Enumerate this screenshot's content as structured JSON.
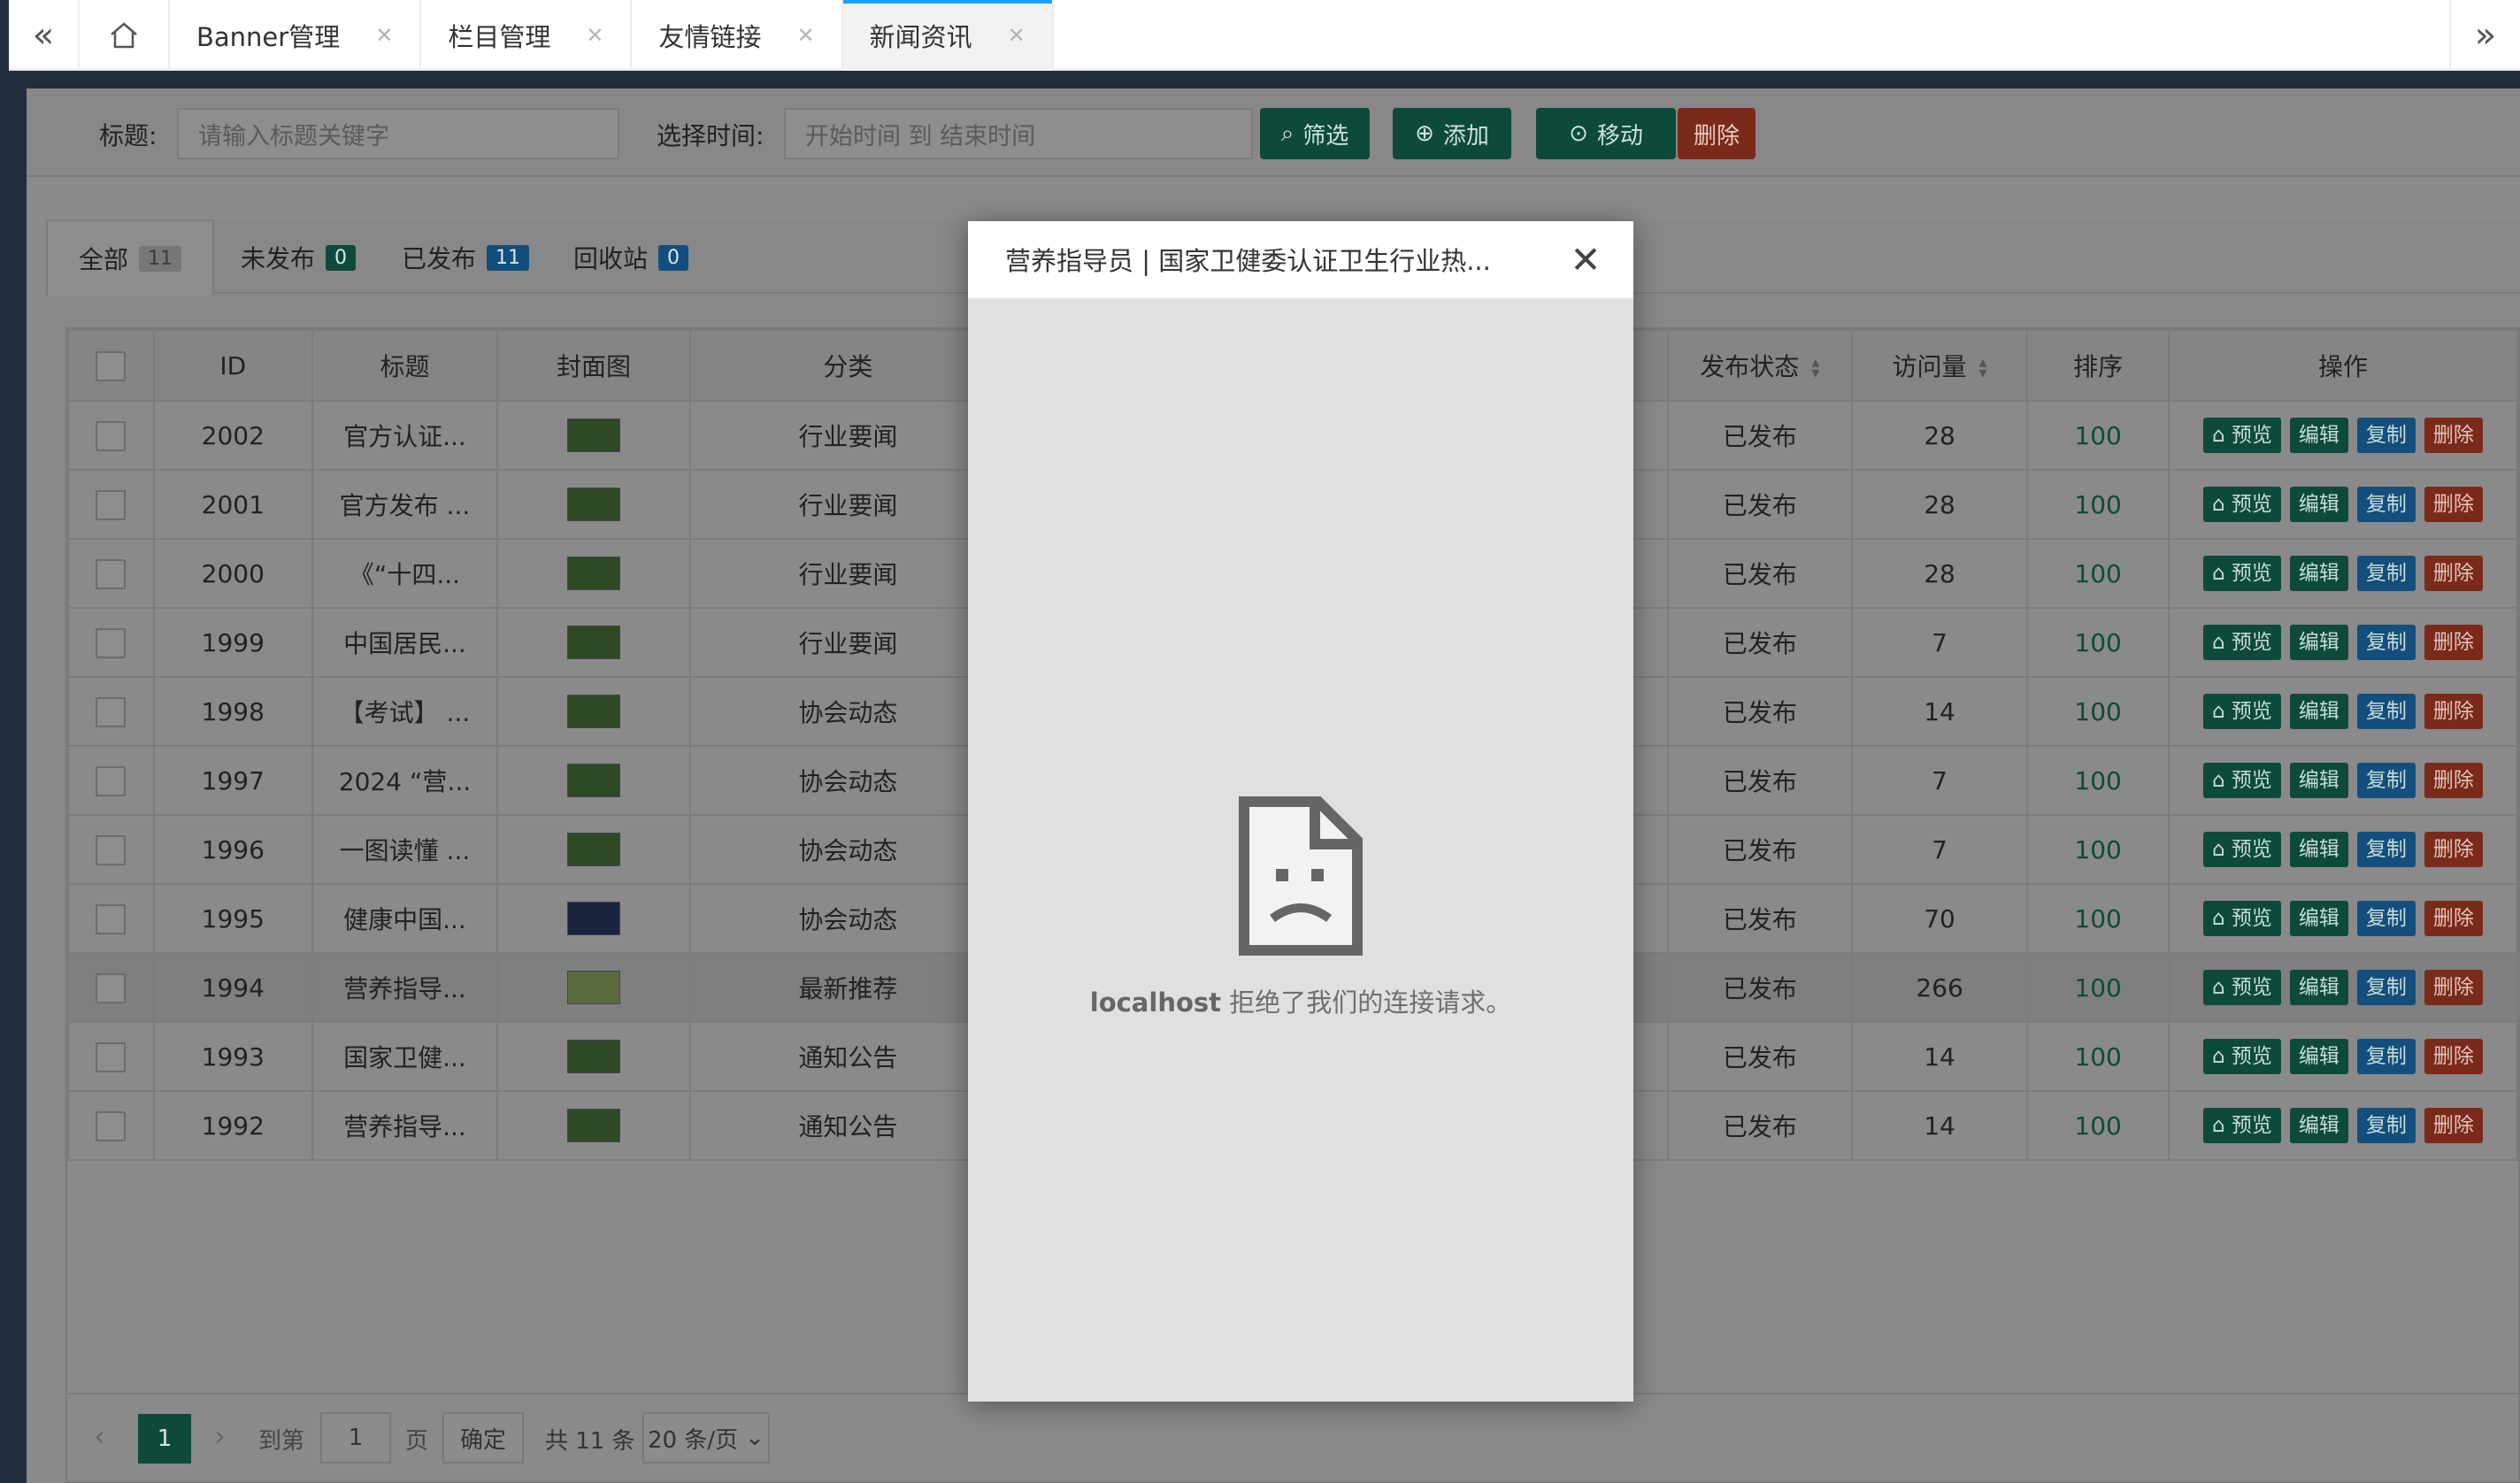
{
  "tabs": [
    {
      "label": "Banner管理",
      "active": false
    },
    {
      "label": "栏目管理",
      "active": false
    },
    {
      "label": "友情链接",
      "active": false
    },
    {
      "label": "新闻资讯",
      "active": true
    }
  ],
  "filter": {
    "title_label": "标题:",
    "title_placeholder": "请输入标题关键字",
    "time_label": "选择时间:",
    "time_placeholder": "开始时间 到 结束时间",
    "btn_filter": "筛选",
    "btn_add": "添加",
    "btn_move": "移动",
    "btn_delete": "删除"
  },
  "status_tabs": [
    {
      "label": "全部",
      "count": "11"
    },
    {
      "label": "未发布",
      "count": "0"
    },
    {
      "label": "已发布",
      "count": "11"
    },
    {
      "label": "回收站",
      "count": "0"
    }
  ],
  "table": {
    "headers": {
      "id": "ID",
      "title": "标题",
      "cover": "封面图",
      "category": "分类",
      "status": "发布状态",
      "views": "访问量",
      "sort": "排序",
      "actions": "操作"
    },
    "actions": {
      "preview": "预览",
      "edit": "编辑",
      "copy": "复制",
      "delete": "删除"
    },
    "rows": [
      {
        "id": "2002",
        "title": "官方认证...",
        "category": "行业要闻",
        "status": "已发布",
        "views": "28",
        "sort": "100"
      },
      {
        "id": "2001",
        "title": "官方发布 ...",
        "category": "行业要闻",
        "status": "已发布",
        "views": "28",
        "sort": "100"
      },
      {
        "id": "2000",
        "title": "《“十四...",
        "category": "行业要闻",
        "status": "已发布",
        "views": "28",
        "sort": "100"
      },
      {
        "id": "1999",
        "title": "中国居民...",
        "category": "行业要闻",
        "status": "已发布",
        "views": "7",
        "sort": "100"
      },
      {
        "id": "1998",
        "title": "【考试】 ...",
        "category": "协会动态",
        "status": "已发布",
        "views": "14",
        "sort": "100"
      },
      {
        "id": "1997",
        "title": "2024 “营...",
        "category": "协会动态",
        "status": "已发布",
        "views": "7",
        "sort": "100"
      },
      {
        "id": "1996",
        "title": "一图读懂 ...",
        "category": "协会动态",
        "status": "已发布",
        "views": "7",
        "sort": "100"
      },
      {
        "id": "1995",
        "title": "健康中国...",
        "category": "协会动态",
        "status": "已发布",
        "views": "70",
        "sort": "100"
      },
      {
        "id": "1994",
        "title": "营养指导...",
        "category": "最新推荐",
        "status": "已发布",
        "views": "266",
        "sort": "100"
      },
      {
        "id": "1993",
        "title": "国家卫健...",
        "category": "通知公告",
        "status": "已发布",
        "views": "14",
        "sort": "100"
      },
      {
        "id": "1992",
        "title": "营养指导...",
        "category": "通知公告",
        "status": "已发布",
        "views": "14",
        "sort": "100"
      }
    ]
  },
  "pager": {
    "current": "1",
    "goto_label": "到第",
    "goto_value": "1",
    "page_label": "页",
    "confirm": "确定",
    "total": "共 11 条",
    "page_size": "20 条/页"
  },
  "modal": {
    "title": "营养指导员 | 国家卫健委认证卫生行业热...",
    "close": "✕",
    "error_host": "localhost",
    "error_msg": " 拒绝了我们的连接请求。"
  }
}
